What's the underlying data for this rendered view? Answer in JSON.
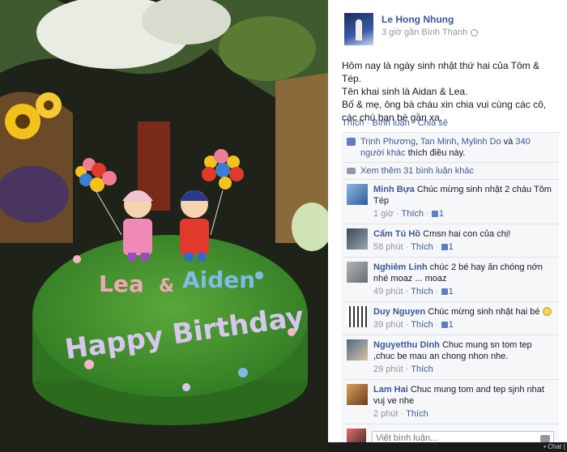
{
  "post": {
    "author": "Le Hong Nhung",
    "meta": "3 giờ gần Bình Thạnh",
    "lines": [
      "Hôm nay là ngày sinh nhật thứ hai của Tôm & Tép.",
      "Tên khai sinh là Aidan & Lea.",
      "Bố & mẹ, ông bà cháu xin chia vui cùng các cô, các chú bạn bè gần xa."
    ],
    "actions": {
      "like": "Thích",
      "comment": "Bình luận",
      "share": "Chia sẻ",
      "dot": "·"
    }
  },
  "photo": {
    "cake_text_1": "Lea",
    "cake_amp": "&",
    "cake_text_2": "Aiden",
    "cake_text_3": "Happy Birthday"
  },
  "likes": {
    "name1": "Trịnh Phương",
    "name2": "Tan Minh",
    "name3": "Mylinh Do",
    "and": "và",
    "others": "340 người khác",
    "suffix": "thích điều này.",
    "sep": ", "
  },
  "more_comments": "Xem thêm 31 bình luận khác",
  "comments": [
    {
      "name": "Minh Bựa",
      "text": "Chúc mừng sinh nhật 2 cháu Tôm Tép",
      "time": "1 giờ",
      "like": "Thích",
      "likes": "1"
    },
    {
      "name": "Cẩm Tú Hồ",
      "text": "Cmsn hai con của chị!",
      "time": "58 phút",
      "like": "Thích",
      "likes": "1"
    },
    {
      "name": "Nghiêm Linh",
      "text": "chúc 2 bé hay ăn chóng nớn nhé moaz ... moaz",
      "time": "49 phút",
      "like": "Thích",
      "likes": "1"
    },
    {
      "name": "Duy Nguyen",
      "text": "Chúc mừng sinh nhật hai bé",
      "time": "39 phút",
      "like": "Thích",
      "likes": "1"
    },
    {
      "name": "Nguyetthu Dinh",
      "text": "Chuc mung sn tom tep ,chuc be mau an chong nhon nhe.",
      "time": "29 phút",
      "like": "Thích"
    },
    {
      "name": "Lam Hai",
      "text": "Chuc mung tom and tep sjnh nhat vuj ve nhe",
      "time": "2 phút",
      "like": "Thích"
    }
  ],
  "composer": {
    "placeholder": "Viết bình luận..."
  },
  "footer": {
    "chat": "• Chat ("
  }
}
